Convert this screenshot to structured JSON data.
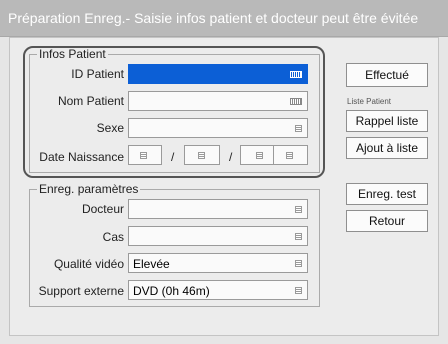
{
  "title": "Préparation Enreg.- Saisie infos patient et docteur peut être évitée",
  "patient": {
    "legend": "Infos Patient",
    "id_label": "ID Patient",
    "id_value": "",
    "name_label": "Nom Patient",
    "name_value": "",
    "sex_label": "Sexe",
    "sex_value": "",
    "dob_label": "Date Naissance",
    "dob_sep1": "/",
    "dob_sep2": "/"
  },
  "params": {
    "legend": "Enreg. paramètres",
    "doctor_label": "Docteur",
    "doctor_value": "",
    "case_label": "Cas",
    "case_value": "",
    "quality_label": "Qualité vidéo",
    "quality_value": "Elevée",
    "media_label": "Support externe",
    "media_value": "DVD (0h 46m)"
  },
  "buttons": {
    "done": "Effectué",
    "patient_list_caption": "Liste Patient",
    "recall_list": "Rappel liste",
    "add_to_list": "Ajout à liste",
    "test_record": "Enreg. test",
    "back": "Retour"
  },
  "colors": {
    "active_field": "#0c5fd6",
    "titlebar": "#b9b9b9"
  }
}
